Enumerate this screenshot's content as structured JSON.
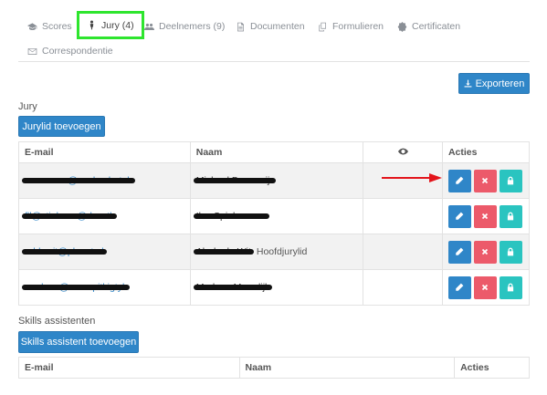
{
  "tabs": [
    {
      "label": "Scores",
      "icon": "graduation-cap-icon"
    },
    {
      "label": "Jury (4)",
      "icon": "person-icon",
      "active": true
    },
    {
      "label": "Deelnemers (9)",
      "icon": "users-icon"
    },
    {
      "label": "Documenten",
      "icon": "document-icon"
    },
    {
      "label": "Formulieren",
      "icon": "copy-icon"
    },
    {
      "label": "Certificaten",
      "icon": "badge-icon"
    },
    {
      "label": "Correspondentie",
      "icon": "envelope-icon"
    }
  ],
  "export_label": "Exporteren",
  "jury": {
    "title": "Jury",
    "add_label": "Jurylid toevoegen",
    "headers": {
      "email": "E-mail",
      "name": "Naam",
      "visible_icon": "eye-icon",
      "actions": "Acties"
    },
    "rows": [
      {
        "email": "c.ocrawns@vanlemhotnb",
        "name": "Michael Boeremijr",
        "role": ""
      },
      {
        "email": "fll@stielmon@dcsatk",
        "name": "Ilse Spielemman",
        "role": ""
      },
      {
        "email": "addewit@planet.nl",
        "name": "Ab de de Wit",
        "role": "Hoofdjurylid"
      },
      {
        "email": "marleen@voorspitkigtyk",
        "name": "Marleen Meerdijk",
        "role": ""
      }
    ]
  },
  "skills": {
    "title": "Skills assistenten",
    "add_label": "Skills assistent toevoegen",
    "headers": {
      "email": "E-mail",
      "name": "Naam",
      "actions": "Acties"
    }
  },
  "colors": {
    "primary": "#2f86c8",
    "danger": "#ec5a6a",
    "info": "#2ac4c0",
    "highlight": "#2ee52e",
    "arrow": "#e3141b"
  }
}
